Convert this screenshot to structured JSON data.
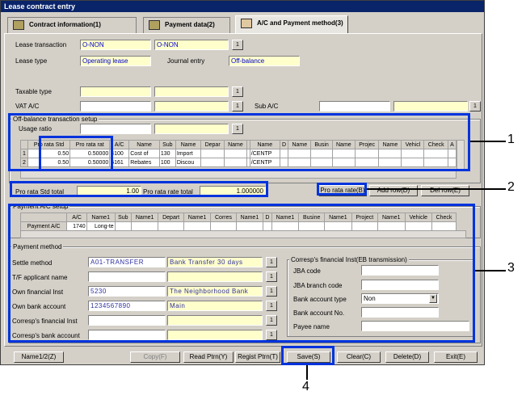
{
  "window": {
    "title": "Lease contract entry"
  },
  "tabs": [
    {
      "label": "Contract information(1)"
    },
    {
      "label": "Payment data(2)"
    },
    {
      "label": "A/C and Payment method(3)"
    }
  ],
  "header": {
    "lease_transaction_label": "Lease transaction",
    "lease_transaction_code": "O-NON",
    "lease_transaction_name": "O-NON",
    "lease_type_label": "Lease type",
    "lease_type_value": "Operating lease",
    "journal_entry_label": "Journal entry",
    "journal_entry_value": "Off-balance",
    "taxable_type_label": "Taxable type",
    "vat_ac_label": "VAT A/C",
    "sub_ac_label": "Sub A/C",
    "dot_label": "1"
  },
  "offbalance": {
    "title": "Off-balance transaction setup",
    "usage_ratio_label": "Usage ratio",
    "columns": [
      "",
      "Pro rata Std",
      "Pro rata rat",
      "A/C",
      "Name",
      "Sub",
      "Name",
      "Depar",
      "Name",
      "",
      "Name",
      "D",
      "Name",
      "Busin",
      "Name",
      "Projec",
      "Name",
      "Vehicl",
      "Check",
      "A"
    ],
    "rows": [
      [
        "1",
        "0.50",
        "0.50000",
        "4100",
        "Cost of",
        "130",
        "Import",
        "",
        "",
        "",
        "/CENTP",
        "",
        "",
        "",
        "",
        "",
        "",
        "",
        "",
        ""
      ],
      [
        "2",
        "0.50",
        "0.50000",
        "5161",
        "Rebates",
        "100",
        "Discou",
        "",
        "",
        "",
        "/CENTP",
        "",
        "",
        "",
        "",
        "",
        "",
        "",
        "",
        ""
      ]
    ],
    "std_total_label": "Pro rata Std total",
    "std_total_value": "1.00",
    "rate_total_label": "Pro rata rate total",
    "rate_total_value": "1.000000",
    "btn_prorate": "Pro rata rate(B)",
    "btn_add": "Add row(D)",
    "btn_delete": "Del row(E)"
  },
  "payment_ac": {
    "title": "Payment A/C setup",
    "columns": [
      "",
      "A/C",
      "Name1",
      "Sub",
      "Name1",
      "Depart",
      "Name1",
      "Corres",
      "Name1",
      "D",
      "Name1",
      "Busine",
      "Name1",
      "Project",
      "Name1",
      "Vehicle",
      "Check"
    ],
    "row": [
      "Payment A/C",
      "1740",
      "Long-te",
      "",
      "",
      "",
      "",
      "",
      "",
      "",
      "",
      "",
      "",
      "",
      "",
      "",
      ""
    ]
  },
  "payment_method": {
    "title": "Payment method",
    "settle_label": "Settle method",
    "settle_code": "A01-TRANSFER",
    "settle_name": "Bank Transfer 30 days",
    "applicant_label": "T/F applicant name",
    "own_inst_label": "Own financial Inst",
    "own_inst_code": "5230",
    "own_inst_name": "The Neighborhood Bank",
    "own_acct_label": "Own bank account",
    "own_acct_code": "1234567890",
    "own_acct_name": "Main",
    "corresp_inst_label": "Corresp's financial Inst",
    "corresp_acct_label": "Corresp's bank account"
  },
  "eb": {
    "title": "Corresp's financial Inst(EB transmission)",
    "jba_code_label": "JBA code",
    "jba_branch_label": "JBA branch code",
    "acct_type_label": "Bank account type",
    "acct_type_value": "Non",
    "acct_no_label": "Bank account No.",
    "payee_label": "Payee name"
  },
  "footer": {
    "name_btn": "Name1/2(Z)",
    "copy_btn": "Copy(F)",
    "read_btn": "Read Ptrn(Y)",
    "regist_btn": "Regist Ptrn(T)",
    "save_btn": "Save(S)",
    "clear_btn": "Clear(C)",
    "delete_btn": "Delete(D)",
    "exit_btn": "Exit(E)"
  },
  "callouts": [
    "1",
    "2",
    "3",
    "4"
  ]
}
